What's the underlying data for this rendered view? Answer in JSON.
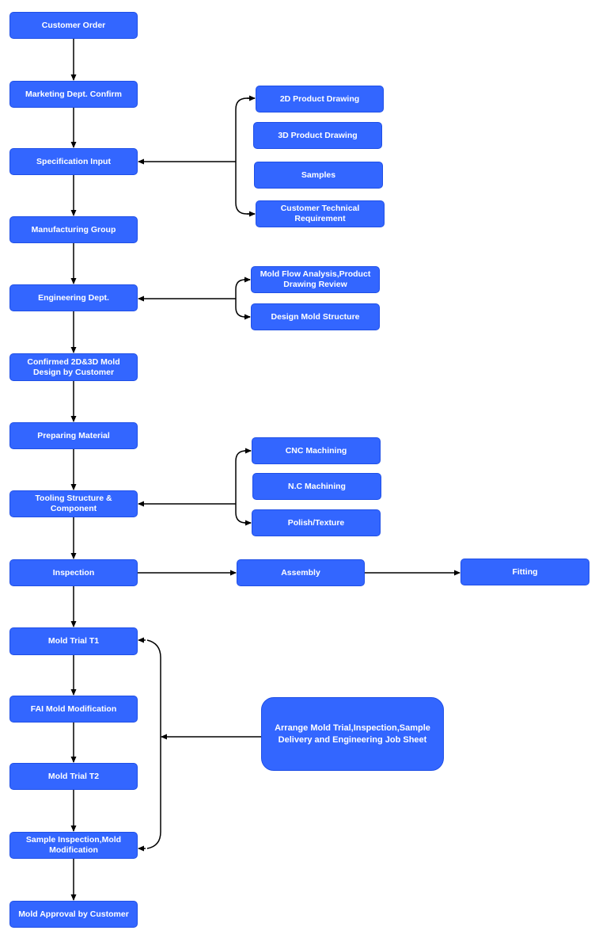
{
  "colors": {
    "box_fill": "#3366ff",
    "box_border": "#1f4fe6",
    "text": "#ffffff",
    "connector": "#000000"
  },
  "main_flow": [
    "Customer Order",
    "Marketing Dept. Confirm",
    "Specification Input",
    "Manufacturing Group",
    "Engineering Dept.",
    "Confirmed 2D&3D Mold Design by Customer",
    "Preparing Material",
    "Tooling Structure & Component",
    "Inspection",
    "Mold Trial T1",
    "FAI Mold Modification",
    "Mold Trial T2",
    "Sample Inspection,Mold Modification",
    "Mold Approval by Customer"
  ],
  "specification_inputs": [
    "2D Product Drawing",
    "3D Product Drawing",
    "Samples",
    "Customer Technical Requirement"
  ],
  "engineering_tasks": [
    "Mold Flow Analysis,Product Drawing Review",
    "Design Mold Structure"
  ],
  "tooling_processes": [
    "CNC Machining",
    "N.C Machining",
    "Polish/Texture"
  ],
  "inspection_chain": [
    "Assembly",
    "Fitting"
  ],
  "trial_support": "Arrange Mold Trial,Inspection,Sample Delivery and Engineering Job Sheet"
}
